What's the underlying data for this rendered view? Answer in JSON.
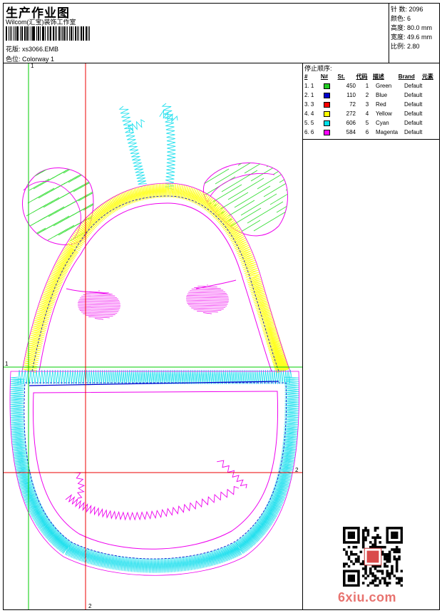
{
  "header": {
    "title": "生产作业图",
    "company": "Wilcom(汇宝)装饰工作室",
    "pattern": "花版: xs3066.EMB",
    "colorway": "色位: Colorway 1"
  },
  "info": {
    "stitches": "针 数: 2096",
    "colors": "颜色: 6",
    "height": "高度: 80.0 mm",
    "width": "宽度: 49.6 mm",
    "scale": "比例: 2.80"
  },
  "thread_table": {
    "title": "停止顺序:",
    "columns": [
      "#",
      "N#",
      "St.",
      "代码",
      "描述",
      "Brand",
      "元素"
    ],
    "rows": [
      {
        "num": "1. 1",
        "color": "#22cc22",
        "st": "450",
        "code": "1",
        "desc": "Green",
        "brand": "Default"
      },
      {
        "num": "2. 1",
        "color": "#0000cc",
        "st": "110",
        "code": "2",
        "desc": "Blue",
        "brand": "Default"
      },
      {
        "num": "3. 3",
        "color": "#ff0000",
        "st": "72",
        "code": "3",
        "desc": "Red",
        "brand": "Default"
      },
      {
        "num": "4. 4",
        "color": "#ffff00",
        "st": "272",
        "code": "4",
        "desc": "Yellow",
        "brand": "Default"
      },
      {
        "num": "5. 5",
        "color": "#00e0e8",
        "st": "606",
        "code": "5",
        "desc": "Cyan",
        "brand": "Default"
      },
      {
        "num": "6. 6",
        "color": "#ff00ff",
        "st": "584",
        "code": "6",
        "desc": "Magenta",
        "brand": "Default"
      }
    ]
  },
  "guides": {
    "green_top": "1",
    "green_left": "1",
    "red_right": "2",
    "red_bottom": "2"
  },
  "colors": {
    "green": "#33dd33",
    "blue": "#0000cc",
    "red": "#ee0000",
    "yellow": "#ffff22",
    "cyan": "#22e0ee",
    "magenta": "#ee00ee"
  },
  "watermark": "6xiu.com"
}
